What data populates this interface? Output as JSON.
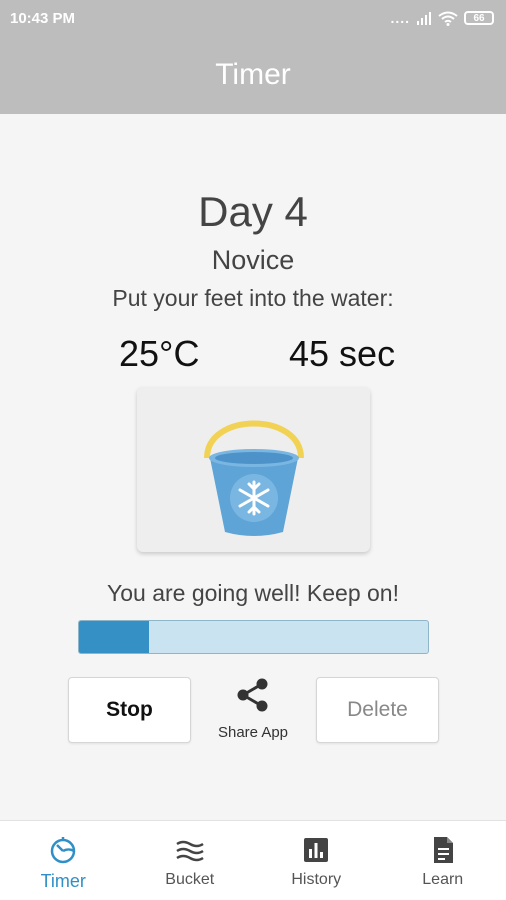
{
  "status_bar": {
    "time": "10:43 PM",
    "signal_dots": "....",
    "battery": "66"
  },
  "app_bar": {
    "title": "Timer"
  },
  "session": {
    "day": "Day 4",
    "level": "Novice",
    "instruction": "Put your feet into the water:",
    "temperature": "25°C",
    "duration": "45 sec",
    "encouragement": "You are going well! Keep on!",
    "progress": 0.2
  },
  "actions": {
    "stop_label": "Stop",
    "share_label": "Share App",
    "delete_label": "Delete"
  },
  "nav": {
    "items": [
      {
        "label": "Timer",
        "icon": "timer-icon",
        "active": true
      },
      {
        "label": "Bucket",
        "icon": "waves-icon",
        "active": false
      },
      {
        "label": "History",
        "icon": "bar-chart-icon",
        "active": false
      },
      {
        "label": "Learn",
        "icon": "document-icon",
        "active": false
      }
    ]
  },
  "colors": {
    "accent": "#2f8fc6",
    "progress_fill": "#3591c5",
    "progress_track": "#c9e3f1",
    "bucket_body": "#5fa4d6",
    "bucket_handle": "#f2d255"
  }
}
